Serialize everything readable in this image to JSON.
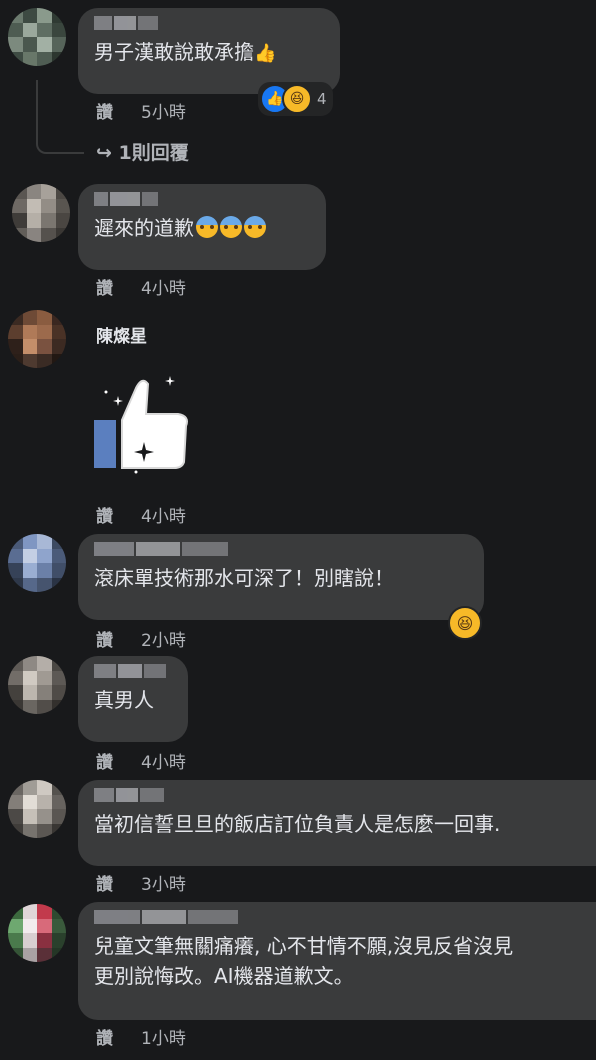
{
  "actions": {
    "like": "讚",
    "replies": "1則回覆",
    "reply_arrow": "↪"
  },
  "comments": [
    {
      "text": "男子漢敢說敢承擔",
      "time": "5小時",
      "reaction_count": "4",
      "emoji": "👍"
    },
    {
      "text": "遲來的道歉",
      "time": "4小時"
    },
    {
      "author": "陳燦星",
      "time": "4小時",
      "sticker": "thumbs-up-sparkle"
    },
    {
      "text": "滾床單技術那水可深了！別瞎說！",
      "time": "2小時"
    },
    {
      "text": "真男人",
      "time": "4小時"
    },
    {
      "text": "當初信誓旦旦的飯店訂位負責人是怎麼一回事.",
      "time": "3小時"
    },
    {
      "text_line1": "兒童文筆無關痛癢, 心不甘情不願,沒見反省沒見",
      "text_line2": "更別說悔改。AI機器道歉文。",
      "time": "1小時"
    }
  ],
  "colors": {
    "background": "#18191b",
    "bubble": "#3a3b3c",
    "text": "#e4e6eb",
    "meta": "#b0b3b8",
    "like_blue": "#1877f2",
    "haha_yellow": "#f7b928"
  }
}
